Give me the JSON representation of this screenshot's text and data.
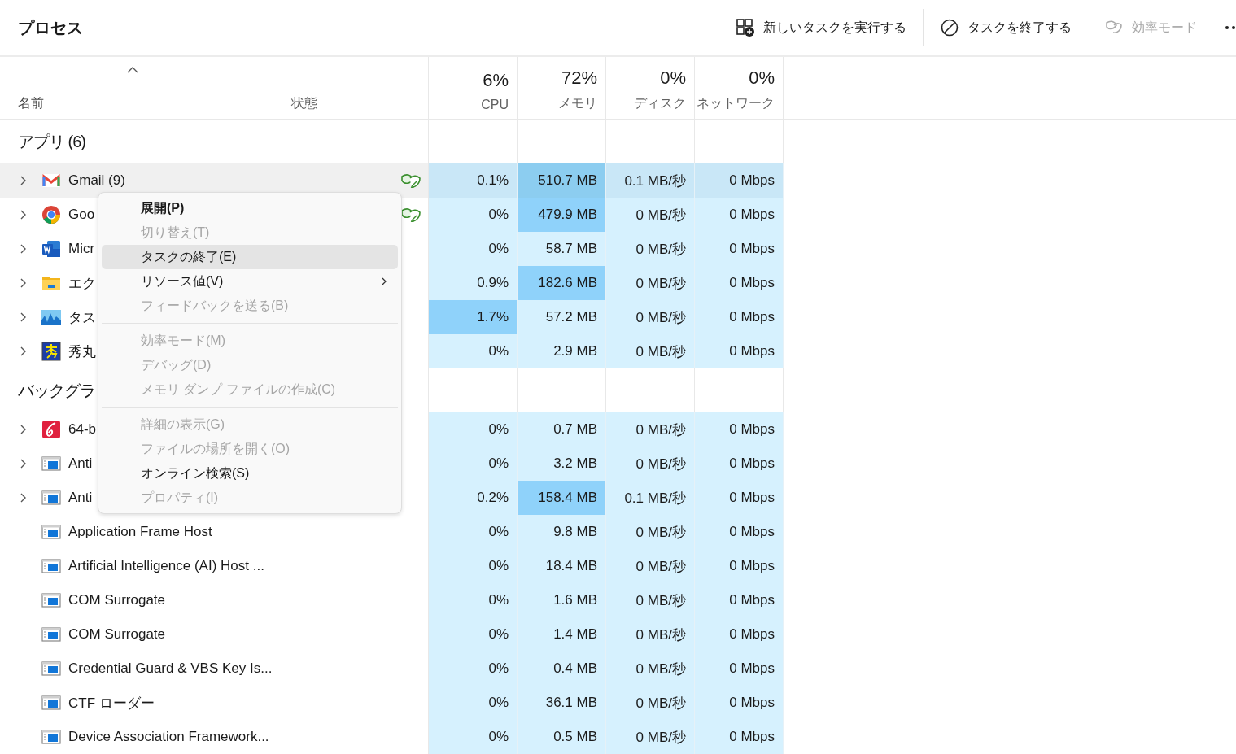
{
  "toolbar": {
    "title": "プロセス",
    "actions": [
      {
        "kind": "run",
        "label": "新しいタスクを実行する",
        "disabled": false
      },
      {
        "kind": "end",
        "label": "タスクを終了する",
        "disabled": false
      },
      {
        "kind": "eco",
        "label": "効率モード",
        "disabled": true
      }
    ]
  },
  "columns": [
    {
      "label": "名前",
      "sorted": true
    },
    {
      "label": "状態",
      "sorted": false
    },
    {
      "label": "CPU",
      "summary": "6%",
      "sorted": false
    },
    {
      "label": "メモリ",
      "summary": "72%",
      "sorted": false
    },
    {
      "label": "ディスク",
      "summary": "0%",
      "sorted": false
    },
    {
      "label": "ネットワーク",
      "summary": "0%",
      "sorted": false
    }
  ],
  "groups": [
    {
      "title": "アプリ (6)",
      "rows": [
        {
          "name": "Gmail (9)",
          "kind": "mail",
          "expandable": true,
          "selected": true,
          "efficiency": true,
          "cells": [
            {
              "value": "0.1%",
              "highlighted": false
            },
            {
              "value": "510.7 MB",
              "highlighted": true
            },
            {
              "value": "0.1 MB/秒",
              "highlighted": false
            },
            {
              "value": "0 Mbps",
              "highlighted": false
            }
          ]
        },
        {
          "name": "Goo",
          "kind": "browser",
          "expandable": true,
          "selected": false,
          "efficiency": true,
          "cells": [
            {
              "value": "0%",
              "highlighted": false
            },
            {
              "value": "479.9 MB",
              "highlighted": true
            },
            {
              "value": "0 MB/秒",
              "highlighted": false
            },
            {
              "value": "0 Mbps",
              "highlighted": false
            }
          ]
        },
        {
          "name": "Micr",
          "kind": "document",
          "expandable": true,
          "selected": false,
          "efficiency": false,
          "cells": [
            {
              "value": "0%",
              "highlighted": false
            },
            {
              "value": "58.7 MB",
              "highlighted": false
            },
            {
              "value": "0 MB/秒",
              "highlighted": false
            },
            {
              "value": "0 Mbps",
              "highlighted": false
            }
          ]
        },
        {
          "name": "エク",
          "kind": "folder",
          "expandable": true,
          "selected": false,
          "efficiency": false,
          "cells": [
            {
              "value": "0.9%",
              "highlighted": false
            },
            {
              "value": "182.6 MB",
              "highlighted": true
            },
            {
              "value": "0 MB/秒",
              "highlighted": false
            },
            {
              "value": "0 Mbps",
              "highlighted": false
            }
          ]
        },
        {
          "name": "タス",
          "kind": "monitor",
          "expandable": true,
          "selected": false,
          "efficiency": false,
          "cells": [
            {
              "value": "1.7%",
              "highlighted": true
            },
            {
              "value": "57.2 MB",
              "highlighted": false
            },
            {
              "value": "0 MB/秒",
              "highlighted": false
            },
            {
              "value": "0 Mbps",
              "highlighted": false
            }
          ]
        },
        {
          "name": "秀丸",
          "kind": "editor",
          "expandable": true,
          "selected": false,
          "efficiency": false,
          "cells": [
            {
              "value": "0%",
              "highlighted": false
            },
            {
              "value": "2.9 MB",
              "highlighted": false
            },
            {
              "value": "0 MB/秒",
              "highlighted": false
            },
            {
              "value": "0 Mbps",
              "highlighted": false
            }
          ]
        }
      ]
    },
    {
      "title": "バックグラ",
      "rows": [
        {
          "name": "64-b",
          "kind": "app",
          "expandable": true,
          "selected": false,
          "efficiency": false,
          "cells": [
            {
              "value": "0%",
              "highlighted": false
            },
            {
              "value": "0.7 MB",
              "highlighted": false
            },
            {
              "value": "0 MB/秒",
              "highlighted": false
            },
            {
              "value": "0 Mbps",
              "highlighted": false
            }
          ]
        },
        {
          "name": "Anti",
          "kind": "service",
          "expandable": true,
          "selected": false,
          "efficiency": false,
          "cells": [
            {
              "value": "0%",
              "highlighted": false
            },
            {
              "value": "3.2 MB",
              "highlighted": false
            },
            {
              "value": "0 MB/秒",
              "highlighted": false
            },
            {
              "value": "0 Mbps",
              "highlighted": false
            }
          ]
        },
        {
          "name": "Anti",
          "kind": "service",
          "expandable": true,
          "selected": false,
          "efficiency": false,
          "cells": [
            {
              "value": "0.2%",
              "highlighted": false
            },
            {
              "value": "158.4 MB",
              "highlighted": true
            },
            {
              "value": "0.1 MB/秒",
              "highlighted": false
            },
            {
              "value": "0 Mbps",
              "highlighted": false
            }
          ]
        },
        {
          "name": "Application Frame Host",
          "kind": "service",
          "expandable": false,
          "selected": false,
          "efficiency": false,
          "cells": [
            {
              "value": "0%",
              "highlighted": false
            },
            {
              "value": "9.8 MB",
              "highlighted": false
            },
            {
              "value": "0 MB/秒",
              "highlighted": false
            },
            {
              "value": "0 Mbps",
              "highlighted": false
            }
          ]
        },
        {
          "name": "Artificial Intelligence (AI) Host ...",
          "kind": "service",
          "expandable": false,
          "selected": false,
          "efficiency": false,
          "cells": [
            {
              "value": "0%",
              "highlighted": false
            },
            {
              "value": "18.4 MB",
              "highlighted": false
            },
            {
              "value": "0 MB/秒",
              "highlighted": false
            },
            {
              "value": "0 Mbps",
              "highlighted": false
            }
          ]
        },
        {
          "name": "COM Surrogate",
          "kind": "service",
          "expandable": false,
          "selected": false,
          "efficiency": false,
          "cells": [
            {
              "value": "0%",
              "highlighted": false
            },
            {
              "value": "1.6 MB",
              "highlighted": false
            },
            {
              "value": "0 MB/秒",
              "highlighted": false
            },
            {
              "value": "0 Mbps",
              "highlighted": false
            }
          ]
        },
        {
          "name": "COM Surrogate",
          "kind": "service",
          "expandable": false,
          "selected": false,
          "efficiency": false,
          "cells": [
            {
              "value": "0%",
              "highlighted": false
            },
            {
              "value": "1.4 MB",
              "highlighted": false
            },
            {
              "value": "0 MB/秒",
              "highlighted": false
            },
            {
              "value": "0 Mbps",
              "highlighted": false
            }
          ]
        },
        {
          "name": "Credential Guard & VBS Key Is...",
          "kind": "service",
          "expandable": false,
          "selected": false,
          "efficiency": false,
          "cells": [
            {
              "value": "0%",
              "highlighted": false
            },
            {
              "value": "0.4 MB",
              "highlighted": false
            },
            {
              "value": "0 MB/秒",
              "highlighted": false
            },
            {
              "value": "0 Mbps",
              "highlighted": false
            }
          ]
        },
        {
          "name": "CTF ローダー",
          "kind": "service",
          "expandable": false,
          "selected": false,
          "efficiency": false,
          "cells": [
            {
              "value": "0%",
              "highlighted": false
            },
            {
              "value": "36.1 MB",
              "highlighted": false
            },
            {
              "value": "0 MB/秒",
              "highlighted": false
            },
            {
              "value": "0 Mbps",
              "highlighted": false
            }
          ]
        },
        {
          "name": "Device Association Framework...",
          "kind": "service",
          "expandable": false,
          "selected": false,
          "efficiency": false,
          "cells": [
            {
              "value": "0%",
              "highlighted": false
            },
            {
              "value": "0.5 MB",
              "highlighted": false
            },
            {
              "value": "0 MB/秒",
              "highlighted": false
            },
            {
              "value": "0 Mbps",
              "highlighted": false
            }
          ]
        }
      ]
    }
  ],
  "context_menu": {
    "items": [
      {
        "kind": "item",
        "label": "展開(P)",
        "default": true,
        "disabled": false,
        "selected": false,
        "submenu": false
      },
      {
        "kind": "item",
        "label": "切り替え(T)",
        "default": false,
        "disabled": true,
        "selected": false,
        "submenu": false
      },
      {
        "kind": "item",
        "label": "タスクの終了(E)",
        "default": false,
        "disabled": false,
        "selected": true,
        "submenu": false
      },
      {
        "kind": "item",
        "label": "リソース値(V)",
        "default": false,
        "disabled": false,
        "selected": false,
        "submenu": true
      },
      {
        "kind": "item",
        "label": "フィードバックを送る(B)",
        "default": false,
        "disabled": true,
        "selected": false,
        "submenu": false
      },
      {
        "kind": "separator"
      },
      {
        "kind": "item",
        "label": "効率モード(M)",
        "default": false,
        "disabled": true,
        "selected": false,
        "submenu": false
      },
      {
        "kind": "item",
        "label": "デバッグ(D)",
        "default": false,
        "disabled": true,
        "selected": false,
        "submenu": false
      },
      {
        "kind": "item",
        "label": "メモリ ダンプ ファイルの作成(C)",
        "default": false,
        "disabled": true,
        "selected": false,
        "submenu": false
      },
      {
        "kind": "separator"
      },
      {
        "kind": "item",
        "label": "詳細の表示(G)",
        "default": false,
        "disabled": true,
        "selected": false,
        "submenu": false
      },
      {
        "kind": "item",
        "label": "ファイルの場所を開く(O)",
        "default": false,
        "disabled": true,
        "selected": false,
        "submenu": false
      },
      {
        "kind": "item",
        "label": "オンライン検索(S)",
        "default": false,
        "disabled": false,
        "selected": false,
        "submenu": false
      },
      {
        "kind": "item",
        "label": "プロパティ(I)",
        "default": false,
        "disabled": true,
        "selected": false,
        "submenu": false
      }
    ]
  }
}
